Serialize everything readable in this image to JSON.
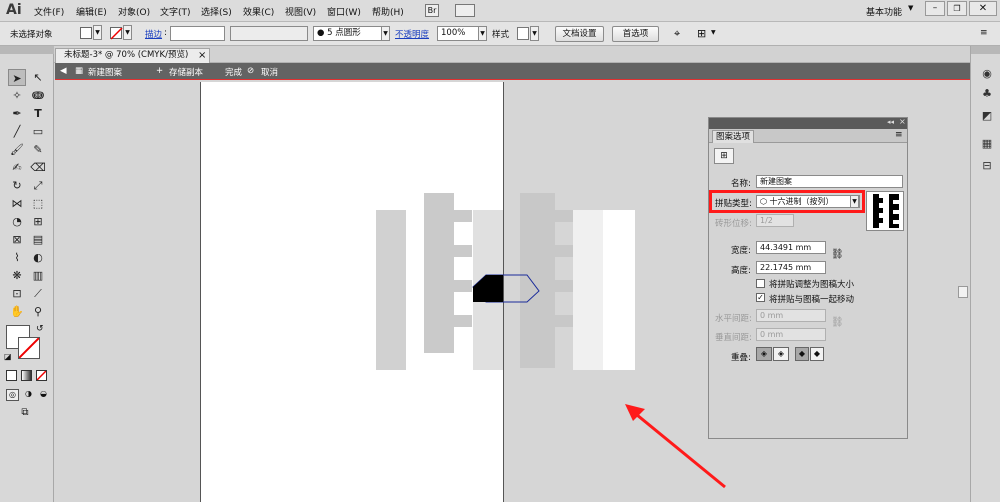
{
  "app": {
    "logo": "Ai",
    "workspace": "基本功能"
  },
  "menu": [
    "文件(F)",
    "编辑(E)",
    "对象(O)",
    "文字(T)",
    "选择(S)",
    "效果(C)",
    "视图(V)",
    "窗口(W)",
    "帮助(H)"
  ],
  "control": {
    "selection_label": "未选择对象",
    "stroke_label": "描边",
    "stroke_unit": ":",
    "brush_value": "5 点圆形",
    "opacity_label": "不透明度",
    "opacity_value": "100%",
    "style_label": "样式",
    "doc_setup": "文档设置",
    "preferences": "首选项"
  },
  "doc_tab": {
    "title": "未标题-3* @ 70% (CMYK/预览)",
    "close": "×"
  },
  "isolation": {
    "name": "新建图案",
    "save_copy": "存储副本",
    "done": "完成",
    "cancel": "取消"
  },
  "dialog": {
    "tab": "图案选项",
    "name_label": "名称:",
    "name_value": "新建图案",
    "tile_type_label": "拼贴类型:",
    "tile_type_value": "十六进制（按列）",
    "brick_offset_label": "砖形位移:",
    "brick_offset_value": "1/2",
    "width_label": "宽度:",
    "width_value": "44.3491 mm",
    "height_label": "高度:",
    "height_value": "22.1745 mm",
    "fit_tile_label": "将拼贴调整为图稿大小",
    "fit_tile_checked": false,
    "move_tile_label": "将拼贴与图稿一起移动",
    "move_tile_checked": true,
    "h_spacing_label": "水平间距:",
    "h_spacing_value": "0 mm",
    "v_spacing_label": "垂直间距:",
    "v_spacing_value": "0 mm",
    "overlap_label": "重叠:"
  },
  "colors": {
    "accent_red": "#ff1a1a",
    "isolation_bar": "#636363"
  }
}
